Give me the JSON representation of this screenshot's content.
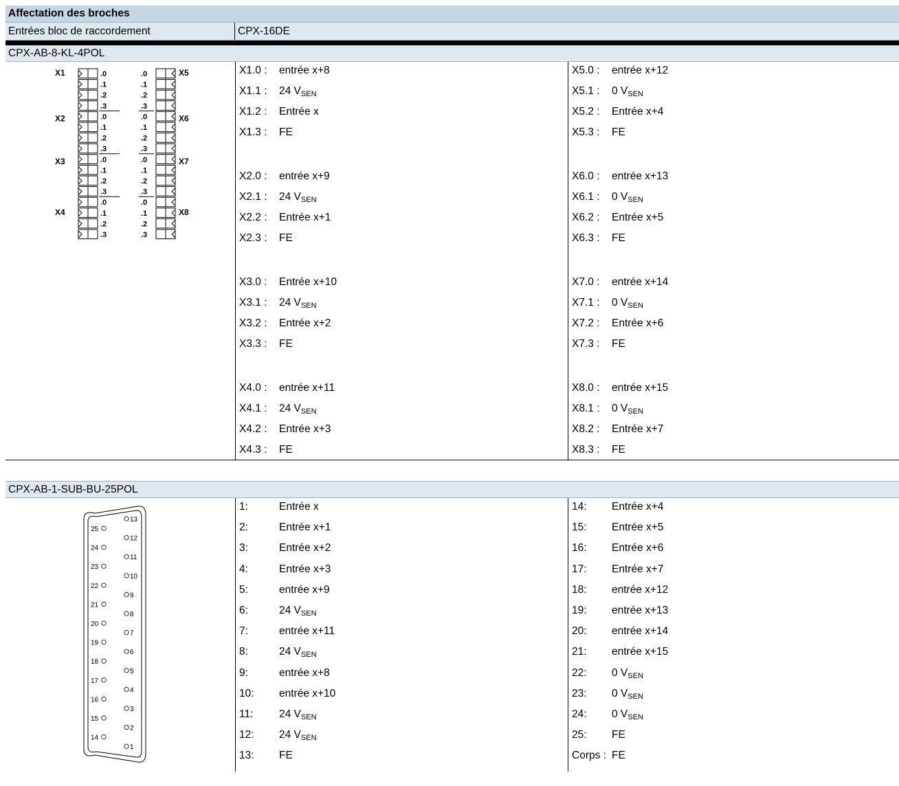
{
  "title": "Affectation des broches",
  "header_row": {
    "label": "Entrées bloc de raccordement",
    "value": "CPX-16DE"
  },
  "section1": {
    "name": "CPX-AB-8-KL-4POL",
    "diagram": {
      "left_labels": [
        "X1",
        "X2",
        "X3",
        "X4"
      ],
      "right_labels": [
        "X5",
        "X6",
        "X7",
        "X8"
      ],
      "pin_labels": [
        ".0",
        ".1",
        ".2",
        ".3"
      ]
    },
    "left_groups": [
      [
        {
          "code": "X1.0 :",
          "text": "entrée x+8",
          "sub": ""
        },
        {
          "code": "X1.1 :",
          "text": "24 V",
          "sub": "SEN"
        },
        {
          "code": "X1.2 :",
          "text": "Entrée x",
          "sub": ""
        },
        {
          "code": "X1.3 :",
          "text": "FE",
          "sub": ""
        }
      ],
      [
        {
          "code": "X2.0 :",
          "text": "entrée x+9",
          "sub": ""
        },
        {
          "code": "X2.1 :",
          "text": "24 V",
          "sub": "SEN"
        },
        {
          "code": "X2.2 :",
          "text": "Entrée x+1",
          "sub": ""
        },
        {
          "code": "X2.3 :",
          "text": "FE",
          "sub": ""
        }
      ],
      [
        {
          "code": "X3.0 :",
          "text": "Entrée x+10",
          "sub": ""
        },
        {
          "code": "X3.1 :",
          "text": "24 V",
          "sub": "SEN"
        },
        {
          "code": "X3.2 :",
          "text": "Entrée x+2",
          "sub": ""
        },
        {
          "code": "X3.3 :",
          "text": "FE",
          "sub": ""
        }
      ],
      [
        {
          "code": "X4.0 :",
          "text": "entrée x+11",
          "sub": ""
        },
        {
          "code": "X4.1 :",
          "text": "24 V",
          "sub": "SEN"
        },
        {
          "code": "X4.2 :",
          "text": "Entrée x+3",
          "sub": ""
        },
        {
          "code": "X4.3 :",
          "text": "FE",
          "sub": ""
        }
      ]
    ],
    "right_groups": [
      [
        {
          "code": "X5.0 :",
          "text": "entrée x+12",
          "sub": ""
        },
        {
          "code": "X5.1 :",
          "text": "0 V",
          "sub": "SEN"
        },
        {
          "code": "X5.2 :",
          "text": "Entrée x+4",
          "sub": ""
        },
        {
          "code": "X5.3 :",
          "text": "FE",
          "sub": ""
        }
      ],
      [
        {
          "code": "X6.0 :",
          "text": "entrée x+13",
          "sub": ""
        },
        {
          "code": "X6.1 :",
          "text": "0 V",
          "sub": "SEN"
        },
        {
          "code": "X6.2 :",
          "text": "Entrée x+5",
          "sub": ""
        },
        {
          "code": "X6.3 :",
          "text": "FE",
          "sub": ""
        }
      ],
      [
        {
          "code": "X7.0 :",
          "text": "entrée x+14",
          "sub": ""
        },
        {
          "code": "X7.1 :",
          "text": "0 V",
          "sub": "SEN"
        },
        {
          "code": "X7.2 :",
          "text": "Entrée x+6",
          "sub": ""
        },
        {
          "code": "X7.3 :",
          "text": "FE",
          "sub": ""
        }
      ],
      [
        {
          "code": "X8.0 :",
          "text": "entrée x+15",
          "sub": ""
        },
        {
          "code": "X8.1 :",
          "text": "0 V",
          "sub": "SEN"
        },
        {
          "code": "X8.2 :",
          "text": "Entrée x+7",
          "sub": ""
        },
        {
          "code": "X8.3 :",
          "text": "FE",
          "sub": ""
        }
      ]
    ]
  },
  "section2": {
    "name": "CPX-AB-1-SUB-BU-25POL",
    "diagram": {
      "left_pins": [
        "25",
        "24",
        "23",
        "22",
        "21",
        "20",
        "19",
        "18",
        "17",
        "16",
        "15",
        "14"
      ],
      "right_pins": [
        "13",
        "12",
        "11",
        "10",
        "9",
        "8",
        "7",
        "6",
        "5",
        "4",
        "3",
        "2",
        "1"
      ]
    },
    "left_pins": [
      {
        "num": "1:",
        "text": "Entrée x",
        "sub": ""
      },
      {
        "num": "2:",
        "text": "Entrée x+1",
        "sub": ""
      },
      {
        "num": "3:",
        "text": "Entrée x+2",
        "sub": ""
      },
      {
        "num": "4:",
        "text": "Entrée x+3",
        "sub": ""
      },
      {
        "num": "5:",
        "text": "entrée x+9",
        "sub": ""
      },
      {
        "num": "6:",
        "text": "24 V",
        "sub": "SEN"
      },
      {
        "num": "7:",
        "text": "entrée x+11",
        "sub": ""
      },
      {
        "num": "8:",
        "text": "24 V",
        "sub": "SEN"
      },
      {
        "num": "9:",
        "text": "entrée x+8",
        "sub": ""
      },
      {
        "num": "10:",
        "text": "entrée x+10",
        "sub": ""
      },
      {
        "num": "11:",
        "text": "24 V",
        "sub": "SEN"
      },
      {
        "num": "12:",
        "text": "24 V",
        "sub": "SEN"
      },
      {
        "num": "13:",
        "text": "FE",
        "sub": ""
      }
    ],
    "right_pins": [
      {
        "num": "14:",
        "text": "Entrée x+4",
        "sub": ""
      },
      {
        "num": "15:",
        "text": "Entrée x+5",
        "sub": ""
      },
      {
        "num": "16:",
        "text": "Entrée x+6",
        "sub": ""
      },
      {
        "num": "17:",
        "text": "Entrée x+7",
        "sub": ""
      },
      {
        "num": "18:",
        "text": "entrée x+12",
        "sub": ""
      },
      {
        "num": "19:",
        "text": "entrée x+13",
        "sub": ""
      },
      {
        "num": "20:",
        "text": "entrée x+14",
        "sub": ""
      },
      {
        "num": "21:",
        "text": "entrée x+15",
        "sub": ""
      },
      {
        "num": "22:",
        "text": "0 V",
        "sub": "SEN"
      },
      {
        "num": "23:",
        "text": "0 V",
        "sub": "SEN"
      },
      {
        "num": "24:",
        "text": "0 V",
        "sub": "SEN"
      },
      {
        "num": "25:",
        "text": "FE",
        "sub": ""
      },
      {
        "num": "Corps :",
        "text": "FE",
        "sub": ""
      }
    ]
  }
}
